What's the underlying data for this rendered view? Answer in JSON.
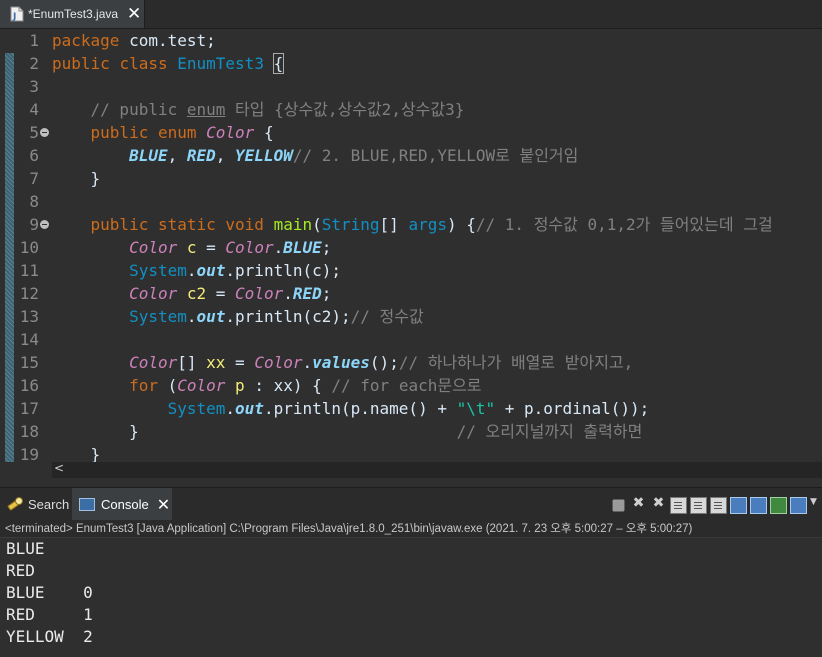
{
  "editor": {
    "tab_title": "*EnumTest3.java",
    "lines": [
      {
        "n": "1",
        "fold": false,
        "code": [
          {
            "t": "package",
            "c": "kw"
          },
          {
            "t": " com.test;"
          }
        ]
      },
      {
        "n": "2",
        "fold": false,
        "code": [
          {
            "t": "public",
            "c": "kw"
          },
          {
            "t": " "
          },
          {
            "t": "class",
            "c": "kw"
          },
          {
            "t": " "
          },
          {
            "t": "EnumTest3",
            "c": "type"
          },
          {
            "t": " "
          },
          {
            "t": "{",
            "c": "brace-box"
          }
        ]
      },
      {
        "n": "3",
        "fold": false,
        "code": []
      },
      {
        "n": "4",
        "fold": false,
        "code": [
          {
            "t": "    "
          },
          {
            "t": "// public ",
            "c": "cm"
          },
          {
            "t": "enum",
            "c": "cm u"
          },
          {
            "t": " 타입 {상수값,상수값2,상수값3}",
            "c": "cm"
          }
        ]
      },
      {
        "n": "5",
        "fold": true,
        "code": [
          {
            "t": "    "
          },
          {
            "t": "public",
            "c": "kw"
          },
          {
            "t": " "
          },
          {
            "t": "enum",
            "c": "kw"
          },
          {
            "t": " "
          },
          {
            "t": "Color",
            "c": "enumref"
          },
          {
            "t": " {"
          }
        ]
      },
      {
        "n": "6",
        "fold": false,
        "code": [
          {
            "t": "        "
          },
          {
            "t": "BLUE",
            "c": "enumc"
          },
          {
            "t": ", "
          },
          {
            "t": "RED",
            "c": "enumc"
          },
          {
            "t": ", "
          },
          {
            "t": "YELLOW",
            "c": "enumc"
          },
          {
            "t": "// 2. BLUE,RED,YELLOW로 붙인거임",
            "c": "cm"
          }
        ]
      },
      {
        "n": "7",
        "fold": false,
        "code": [
          {
            "t": "    }"
          }
        ]
      },
      {
        "n": "8",
        "fold": false,
        "code": []
      },
      {
        "n": "9",
        "fold": true,
        "code": [
          {
            "t": "    "
          },
          {
            "t": "public",
            "c": "kw"
          },
          {
            "t": " "
          },
          {
            "t": "static",
            "c": "kw"
          },
          {
            "t": " "
          },
          {
            "t": "void",
            "c": "kw"
          },
          {
            "t": " "
          },
          {
            "t": "main",
            "c": "method"
          },
          {
            "t": "("
          },
          {
            "t": "String",
            "c": "type"
          },
          {
            "t": "[] "
          },
          {
            "t": "args",
            "c": "type"
          },
          {
            "t": ") {"
          },
          {
            "t": "// 1. 정수값 0,1,2가 들어있는데 그걸",
            "c": "cm"
          }
        ]
      },
      {
        "n": "10",
        "fold": false,
        "code": [
          {
            "t": "        "
          },
          {
            "t": "Color",
            "c": "enumref"
          },
          {
            "t": " "
          },
          {
            "t": "c",
            "c": "var"
          },
          {
            "t": " = "
          },
          {
            "t": "Color",
            "c": "enumref"
          },
          {
            "t": "."
          },
          {
            "t": "BLUE",
            "c": "field"
          },
          {
            "t": ";"
          }
        ]
      },
      {
        "n": "11",
        "fold": false,
        "code": [
          {
            "t": "        "
          },
          {
            "t": "System",
            "c": "type"
          },
          {
            "t": "."
          },
          {
            "t": "out",
            "c": "field"
          },
          {
            "t": ".println(c);"
          }
        ]
      },
      {
        "n": "12",
        "fold": false,
        "code": [
          {
            "t": "        "
          },
          {
            "t": "Color",
            "c": "enumref"
          },
          {
            "t": " "
          },
          {
            "t": "c2",
            "c": "var"
          },
          {
            "t": " = "
          },
          {
            "t": "Color",
            "c": "enumref"
          },
          {
            "t": "."
          },
          {
            "t": "RED",
            "c": "field"
          },
          {
            "t": ";"
          }
        ]
      },
      {
        "n": "13",
        "fold": false,
        "code": [
          {
            "t": "        "
          },
          {
            "t": "System",
            "c": "type"
          },
          {
            "t": "."
          },
          {
            "t": "out",
            "c": "field"
          },
          {
            "t": ".println(c2);"
          },
          {
            "t": "// 정수값",
            "c": "cm"
          }
        ]
      },
      {
        "n": "14",
        "fold": false,
        "code": []
      },
      {
        "n": "15",
        "fold": false,
        "code": [
          {
            "t": "        "
          },
          {
            "t": "Color",
            "c": "enumref"
          },
          {
            "t": "[] "
          },
          {
            "t": "xx",
            "c": "var"
          },
          {
            "t": " = "
          },
          {
            "t": "Color",
            "c": "enumref"
          },
          {
            "t": "."
          },
          {
            "t": "values",
            "c": "field"
          },
          {
            "t": "();"
          },
          {
            "t": "// 하나하나가 배열로 받아지고,",
            "c": "cm"
          }
        ]
      },
      {
        "n": "16",
        "fold": false,
        "code": [
          {
            "t": "        "
          },
          {
            "t": "for",
            "c": "kw"
          },
          {
            "t": " ("
          },
          {
            "t": "Color",
            "c": "enumref"
          },
          {
            "t": " "
          },
          {
            "t": "p",
            "c": "var"
          },
          {
            "t": " : xx) { "
          },
          {
            "t": "// for each문으로",
            "c": "cm"
          }
        ]
      },
      {
        "n": "17",
        "fold": false,
        "code": [
          {
            "t": "            "
          },
          {
            "t": "System",
            "c": "type"
          },
          {
            "t": "."
          },
          {
            "t": "out",
            "c": "field"
          },
          {
            "t": ".println(p.name() + "
          },
          {
            "t": "\"\\t\"",
            "c": "str"
          },
          {
            "t": " + p.ordinal());"
          }
        ]
      },
      {
        "n": "18",
        "fold": false,
        "code": [
          {
            "t": "        }                                 "
          },
          {
            "t": "// 오리지널까지 출력하면",
            "c": "cm"
          }
        ]
      },
      {
        "n": "19",
        "fold": false,
        "code": [
          {
            "t": "    }"
          }
        ]
      }
    ]
  },
  "console": {
    "search_tab_label": "Search",
    "console_tab_label": "Console",
    "status": "<terminated> EnumTest3 [Java Application] C:\\Program Files\\Java\\jre1.8.0_251\\bin\\javaw.exe  (2021. 7. 23 오후 5:00:27 – 오후 5:00:27)",
    "output": [
      "BLUE",
      "RED",
      "BLUE    0",
      "RED     1",
      "YELLOW  2"
    ]
  },
  "colors": {
    "keyword": "#cc6c1d",
    "type": "#1290c3",
    "enum_ref": "#cc81ba",
    "enum_const": "#8dd6f9",
    "comment": "#808080",
    "variable": "#f3ec79",
    "string": "#17c6a3",
    "method": "#a7ec21",
    "background": "#2f2f2f"
  }
}
